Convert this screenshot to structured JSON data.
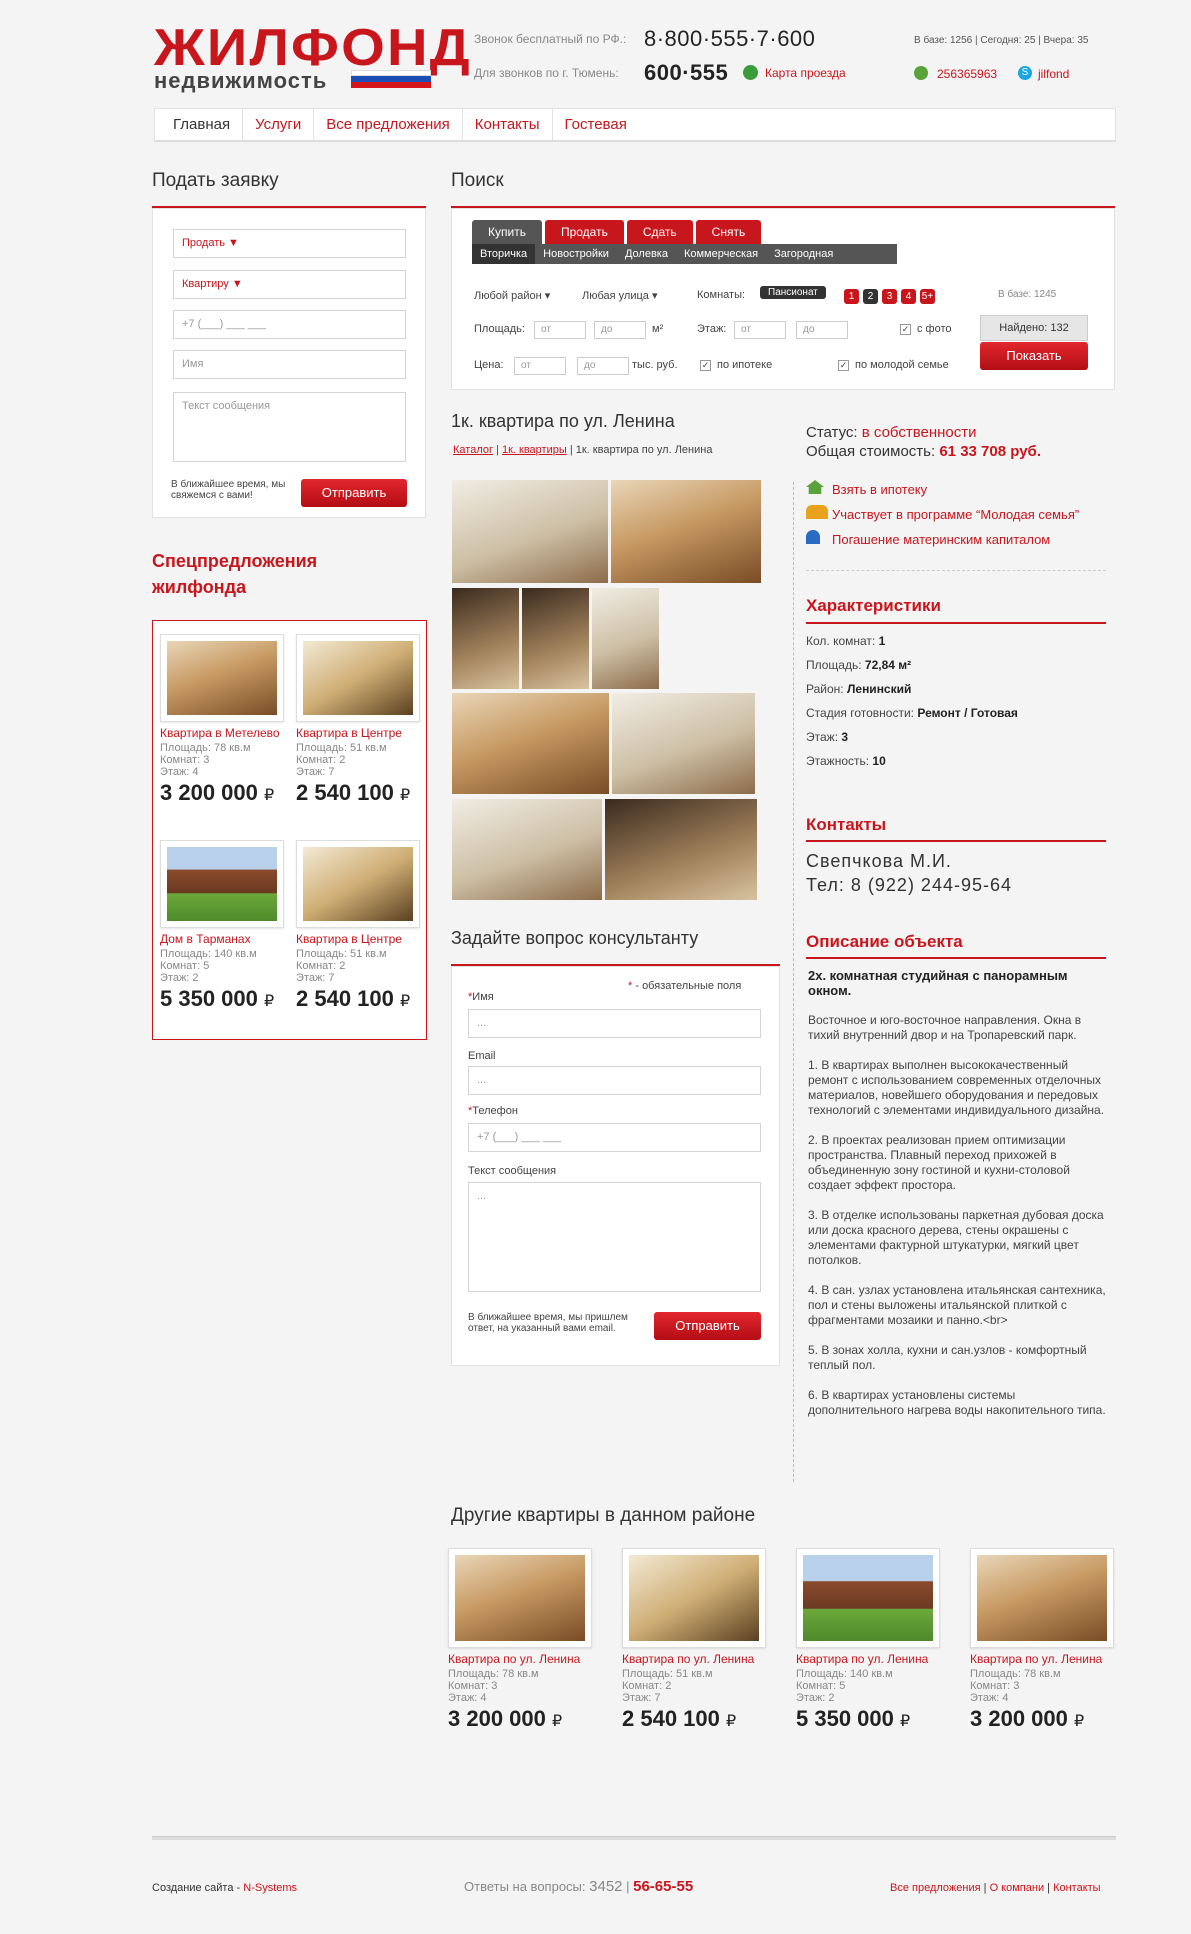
{
  "header": {
    "logo_main": "ЖИЛФОНД",
    "logo_sub": "недвижимость",
    "free_call_label": "Звонок бесплатный по РФ.:",
    "free_call_phone": "8·800·555·7·600",
    "local_call_label": "Для звонков по г. Тюмень:",
    "local_phone": "600·555",
    "map_link": "Карта проезда",
    "stats": "В базе: 1256 | Сегодня: 25 | Вчера: 35",
    "icq": "256365963",
    "skype": "jilfond"
  },
  "nav": [
    "Главная",
    "Услуги",
    "Все предложения",
    "Контакты",
    "Гостевая"
  ],
  "request": {
    "title": "Подать заявку",
    "select_action": "Продать",
    "select_type": "Квартиру",
    "phone_placeholder": "+7 (___) ___ ___",
    "name_placeholder": "Имя",
    "msg_placeholder": "Текст сообщения",
    "note": "В ближайшее время, мы свяжемся с вами!",
    "submit": "Отправить"
  },
  "special": {
    "title": "Спецпредложения жилфонда",
    "items": [
      {
        "title": "Квартира в Метелево",
        "area": "Площадь: 78 кв.м",
        "rooms": "Комнат: 3",
        "floor": "Этаж: 4",
        "price": "3 200 000",
        "currency": "₽"
      },
      {
        "title": "Квартира в Центре",
        "area": "Площадь: 51 кв.м",
        "rooms": "Комнат: 2",
        "floor": "Этаж: 7",
        "price": "2 540 100",
        "currency": "₽"
      },
      {
        "title": "Дом в Тарманах",
        "area": "Площадь: 140 кв.м",
        "rooms": "Комнат: 5",
        "floor": "Этаж: 2",
        "price": "5 350 000",
        "currency": "₽"
      },
      {
        "title": "Квартира в Центре",
        "area": "Площадь: 51 кв.м",
        "rooms": "Комнат: 2",
        "floor": "Этаж: 7",
        "price": "2 540 100",
        "currency": "₽"
      }
    ]
  },
  "search": {
    "title": "Поиск",
    "tabs": [
      "Купить",
      "Продать",
      "Сдать",
      "Снять"
    ],
    "subtabs": [
      "Вторичка",
      "Новостройки",
      "Долевка",
      "Коммерческая",
      "Загородная"
    ],
    "district": "Любой район",
    "street": "Любая улица",
    "rooms_label": "Комнаты:",
    "rooms_pension": "Пансионат",
    "rooms": [
      "1",
      "2",
      "3",
      "4",
      "5+"
    ],
    "base": "В базе: 1245",
    "area_label": "Площадь:",
    "from": "от",
    "to": "до",
    "area_unit": "м²",
    "floor_label": "Этаж:",
    "photo_label": "с фото",
    "found": "Найдено: 132",
    "show": "Показать",
    "price_label": "Цена:",
    "price_unit": "тыс. руб.",
    "mortgage": "по ипотеке",
    "young": "по молодой семье"
  },
  "object": {
    "title": "1к. квартира по ул. Ленина",
    "breadcrumbs": [
      "Каталог",
      "1к. квартиры",
      "1к. квартира по ул. Ленина"
    ],
    "status_label": "Статус:",
    "status": "в собственности",
    "cost_label": "Общая стоимость:",
    "cost": "61 33 708 руб.",
    "links": [
      "Взять в ипотеку",
      "Участвует в программе “Молодая семья”",
      "Погашение материнским капиталом"
    ]
  },
  "chars": {
    "title": "Характеристики",
    "rows": [
      [
        "Кол. комнат:",
        "1"
      ],
      [
        "Площадь:",
        "72,84 м²"
      ],
      [
        "Район:",
        "Ленинский"
      ],
      [
        "Стадия готовности:",
        "Ремонт / Готовая"
      ],
      [
        "Этаж:",
        "3"
      ],
      [
        "Этажность:",
        "10"
      ]
    ]
  },
  "contacts": {
    "title": "Контакты",
    "name": "Свепчкова М.И.",
    "phone": "Тел: 8 (922) 244-95-64"
  },
  "description": {
    "title": "Описание объекта",
    "heading": "2х. комнатная студийная с панорамным окном.",
    "paragraphs": [
      "Восточное и юго-восточное направления. Окна в тихий внутренний двор и на Тропаревский парк.",
      "1.  В квартирах выполнен высококачественный ремонт  с использованием современных отделочных материалов, новейшего оборудования и передовых технологий с элементами индивидуального дизайна.",
      "2.  В проектах реализован прием оптимизации пространства. Плавный переход прихожей в объединенную зону гостиной и кухни-столовой создает эффект  простора.",
      "3.  В отделке использованы  паркетная дубовая доска или доска красного дерева, стены окрашены с элементами фактурной штукатурки, мягкий цвет потолков.",
      "4.  В сан. узлах установлена итальянская сантехника, пол и стены выложены итальянской плиткой с фрагментами мозаики и панно.<br>",
      "5.  В зонах холла, кухни и сан.узлов - комфортный теплый пол.",
      "6.  В квартирах  установлены  системы дополнительного нагрева воды накопительного типа."
    ]
  },
  "question": {
    "title": "Задайте вопрос консультанту",
    "required": "- обязательные поля",
    "name": "Имя",
    "email": "Email",
    "phone": "Телефон",
    "msg": "Текст сообщения",
    "dots": "...",
    "phone_placeholder": "+7 (___) ___ ___",
    "note": "В ближайшее время, мы пришлем ответ, на указанный вами email.",
    "submit": "Отправить"
  },
  "others": {
    "title": "Другие квартиры в данном районе",
    "items": [
      {
        "title": "Квартира по ул. Ленина",
        "area": "Площадь: 78 кв.м",
        "rooms": "Комнат: 3",
        "floor": "Этаж: 4",
        "price": "3 200 000",
        "currency": "₽"
      },
      {
        "title": "Квартира по ул. Ленина",
        "area": "Площадь: 51 кв.м",
        "rooms": "Комнат: 2",
        "floor": "Этаж: 7",
        "price": "2 540 100",
        "currency": "₽"
      },
      {
        "title": "Квартира по ул. Ленина",
        "area": "Площадь: 140 кв.м",
        "rooms": "Комнат: 5",
        "floor": "Этаж: 2",
        "price": "5 350 000",
        "currency": "₽"
      },
      {
        "title": "Квартира по ул. Ленина",
        "area": "Площадь: 78 кв.м",
        "rooms": "Комнат: 3",
        "floor": "Этаж: 4",
        "price": "3 200 000",
        "currency": "₽"
      }
    ]
  },
  "footer": {
    "created_label": "Создание сайта -",
    "created_by": "N-Systems",
    "answers": "Ответы на вопросы:",
    "code": "3452",
    "phone": "56-65-55",
    "links": [
      "Все предложения",
      "О компани",
      "Контакты"
    ]
  },
  "colors": {
    "accent": "#c8161d",
    "dark": "#333333"
  }
}
